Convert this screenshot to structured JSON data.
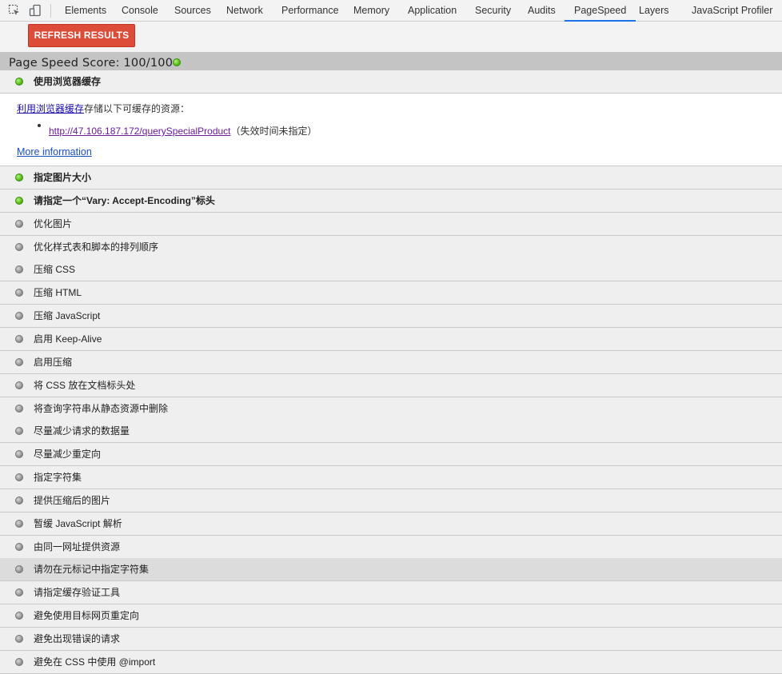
{
  "devtools": {
    "tabs": [
      {
        "label": "Elements"
      },
      {
        "label": "Console"
      },
      {
        "label": "Sources"
      },
      {
        "label": "Network"
      },
      {
        "label": "Performance"
      },
      {
        "label": "Memory"
      },
      {
        "label": "Application"
      },
      {
        "label": "Security"
      },
      {
        "label": "Audits"
      },
      {
        "label": "PageSpeed"
      },
      {
        "label": "Layers"
      },
      {
        "label": "JavaScript Profiler"
      }
    ],
    "active_tab": "PageSpeed",
    "icons": [
      "inspect-element-icon",
      "device-toolbar-icon"
    ],
    "accent_color": "#1a73e8"
  },
  "pagespeed": {
    "refresh_label": "REFRESH RESULTS",
    "refresh_color": "#dd4b39",
    "score_label": "Page Speed Score: 100/100",
    "score_status": "green",
    "expanded_rule": {
      "link_text": "利用浏览器缓存",
      "description_suffix": "存储以下可缓存的资源：",
      "resource_url": "http://47.106.187.172/querySpecialProduct",
      "resource_note": "（失效时间未指定）",
      "more_info": "More information"
    },
    "rules": [
      {
        "label": "使用浏览器缓存",
        "status": "green",
        "bold": true,
        "expanded": true
      },
      {
        "label": "指定图片大小",
        "status": "green",
        "bold": true
      },
      {
        "label": "请指定一个“Vary: Accept-Encoding”标头",
        "status": "green",
        "bold": true
      },
      {
        "label": "优化图片",
        "status": "gray"
      },
      {
        "label": "优化样式表和脚本的排列顺序",
        "status": "gray"
      },
      {
        "label": "压缩 CSS",
        "status": "gray"
      },
      {
        "label": "压缩 HTML",
        "status": "gray"
      },
      {
        "label": "压缩 JavaScript",
        "status": "gray"
      },
      {
        "label": "启用 Keep-Alive",
        "status": "gray"
      },
      {
        "label": "启用压缩",
        "status": "gray"
      },
      {
        "label": "将 CSS 放在文档标头处",
        "status": "gray"
      },
      {
        "label": "将查询字符串从静态资源中删除",
        "status": "gray"
      },
      {
        "label": "尽量减少请求的数据量",
        "status": "gray"
      },
      {
        "label": "尽量减少重定向",
        "status": "gray"
      },
      {
        "label": "指定字符集",
        "status": "gray"
      },
      {
        "label": "提供压缩后的图片",
        "status": "gray"
      },
      {
        "label": "暂缓 JavaScript 解析",
        "status": "gray"
      },
      {
        "label": "由同一网址提供资源",
        "status": "gray"
      },
      {
        "label": "请勿在元标记中指定字符集",
        "status": "gray",
        "highlighted": true
      },
      {
        "label": "请指定缓存验证工具",
        "status": "gray"
      },
      {
        "label": "避免使用目标网页重定向",
        "status": "gray"
      },
      {
        "label": "避免出现错误的请求",
        "status": "gray"
      },
      {
        "label": "避免在 CSS 中使用 @import",
        "status": "gray"
      }
    ]
  }
}
